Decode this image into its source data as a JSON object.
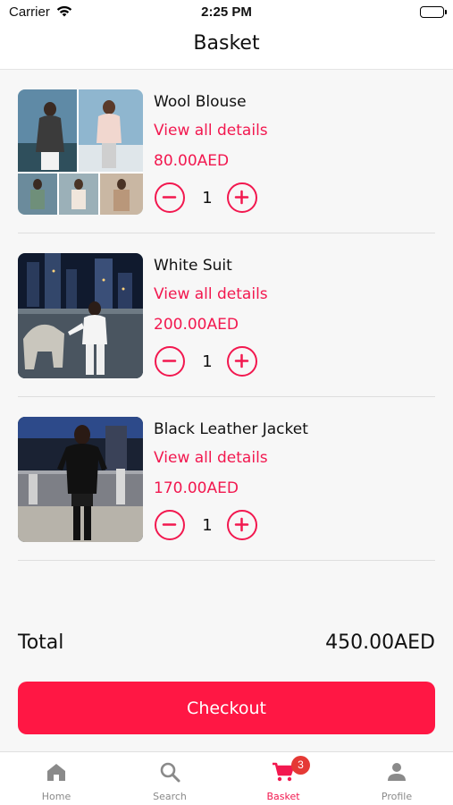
{
  "status_bar": {
    "carrier": "Carrier",
    "time": "2:25 PM"
  },
  "header": {
    "title": "Basket"
  },
  "items": [
    {
      "name": "Wool Blouse",
      "details_label": "View all details",
      "price": "80.00AED",
      "quantity": "1",
      "image": "photo-collage-blouse"
    },
    {
      "name": "White Suit",
      "details_label": "View all details",
      "price": "200.00AED",
      "quantity": "1",
      "image": "photo-white-suit-night"
    },
    {
      "name": "Black Leather Jacket",
      "details_label": "View all details",
      "price": "170.00AED",
      "quantity": "1",
      "image": "photo-leather-jacket-night"
    }
  ],
  "summary": {
    "total_label": "Total",
    "total_value": "450.00AED"
  },
  "checkout": {
    "label": "Checkout"
  },
  "tab_bar": {
    "tabs": [
      {
        "label": "Home",
        "icon": "home-icon"
      },
      {
        "label": "Search",
        "icon": "search-icon"
      },
      {
        "label": "Basket",
        "icon": "cart-icon",
        "badge": "3"
      },
      {
        "label": "Profile",
        "icon": "person-icon"
      }
    ]
  },
  "colors": {
    "accent": "#f2184f",
    "button": "#ff1744",
    "badge": "#e53935"
  }
}
